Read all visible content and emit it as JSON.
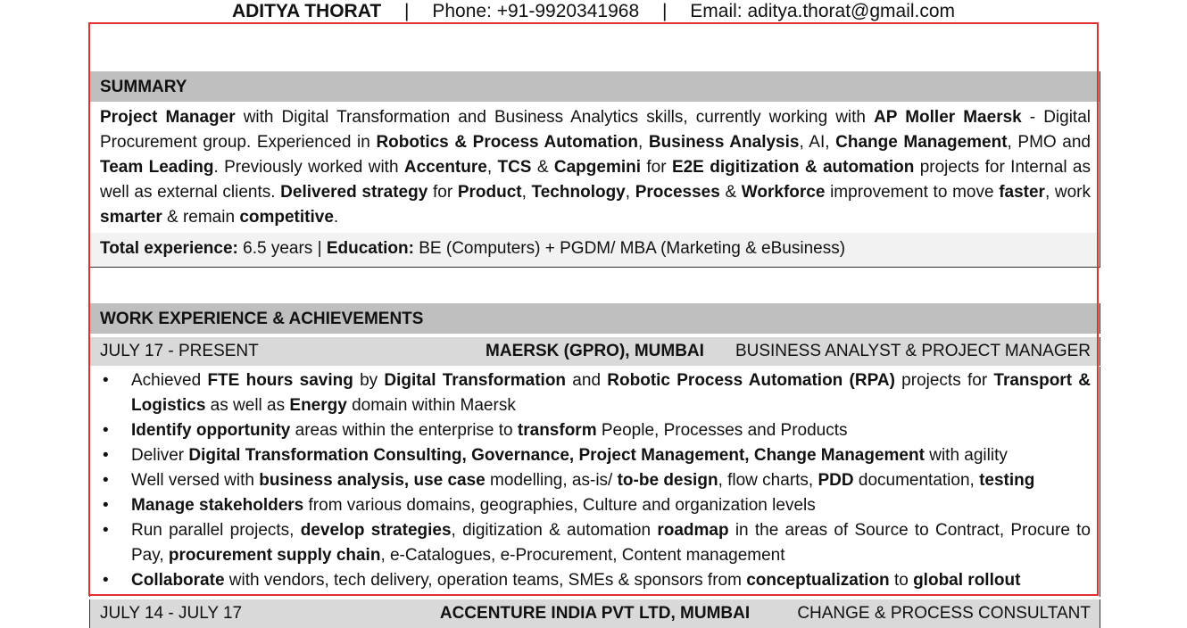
{
  "header": {
    "name": "ADITYA THORAT",
    "separator": "|",
    "phone": "Phone: +91-9920341968",
    "email": "Email: aditya.thorat@gmail.com"
  },
  "summary": {
    "heading": "SUMMARY",
    "segments": [
      {
        "t": "Project Manager",
        "b": true
      },
      {
        "t": " with Digital Transformation and Business Analytics skills, currently working with ",
        "b": false
      },
      {
        "t": "AP Moller Maersk",
        "b": true
      },
      {
        "t": " - Digital Procurement group. Experienced in ",
        "b": false
      },
      {
        "t": "Robotics & Process Automation",
        "b": true
      },
      {
        "t": ", ",
        "b": false
      },
      {
        "t": "Business Analysis",
        "b": true
      },
      {
        "t": ", AI, ",
        "b": false
      },
      {
        "t": "Change Management",
        "b": true
      },
      {
        "t": ", PMO and ",
        "b": false
      },
      {
        "t": "Team Leading",
        "b": true
      },
      {
        "t": ". Previously worked with ",
        "b": false
      },
      {
        "t": "Accenture",
        "b": true
      },
      {
        "t": ", ",
        "b": false
      },
      {
        "t": "TCS",
        "b": true
      },
      {
        "t": " & ",
        "b": false
      },
      {
        "t": "Capgemini",
        "b": true
      },
      {
        "t": " for ",
        "b": false
      },
      {
        "t": "E2E digitization & automation",
        "b": true
      },
      {
        "t": " projects for Internal as well as external clients. ",
        "b": false
      },
      {
        "t": "Delivered strategy",
        "b": true
      },
      {
        "t": " for ",
        "b": false
      },
      {
        "t": "Product",
        "b": true
      },
      {
        "t": ", ",
        "b": false
      },
      {
        "t": "Technology",
        "b": true
      },
      {
        "t": ", ",
        "b": false
      },
      {
        "t": "Processes",
        "b": true
      },
      {
        "t": " & ",
        "b": false
      },
      {
        "t": "Workforce",
        "b": true
      },
      {
        "t": " improvement to move ",
        "b": false
      },
      {
        "t": "faster",
        "b": true
      },
      {
        "t": ", work ",
        "b": false
      },
      {
        "t": "smarter",
        "b": true
      },
      {
        "t": " & remain ",
        "b": false
      },
      {
        "t": "competitive",
        "b": true
      },
      {
        "t": ".",
        "b": false
      }
    ],
    "totals": [
      {
        "t": "Total experience:",
        "b": true
      },
      {
        "t": " 6.5 years | ",
        "b": false
      },
      {
        "t": "Education:",
        "b": true
      },
      {
        "t": " BE (Computers) + PGDM/ MBA (Marketing & eBusiness)",
        "b": false
      }
    ]
  },
  "work": {
    "heading": "WORK EXPERIENCE & ACHIEVEMENTS",
    "jobs": [
      {
        "date": "JULY 17 - PRESENT",
        "company": "MAERSK (GPRO), MUMBAI",
        "role": "BUSINESS ANALYST & PROJECT MANAGER"
      },
      {
        "date": "JULY 14 - JULY 17",
        "company": "ACCENTURE INDIA PVT LTD, MUMBAI",
        "role": "CHANGE & PROCESS CONSULTANT"
      }
    ],
    "bullet_symbol": "•",
    "bullets": [
      [
        {
          "t": "Achieved ",
          "b": false
        },
        {
          "t": "FTE hours saving",
          "b": true
        },
        {
          "t": " by ",
          "b": false
        },
        {
          "t": "Digital Transformation",
          "b": true
        },
        {
          "t": " and ",
          "b": false
        },
        {
          "t": "Robotic Process Automation (RPA)",
          "b": true
        },
        {
          "t": " projects for ",
          "b": false
        },
        {
          "t": "Transport & Logistics",
          "b": true
        },
        {
          "t": " as well as ",
          "b": false
        },
        {
          "t": "Energy",
          "b": true
        },
        {
          "t": " domain within Maersk",
          "b": false
        }
      ],
      [
        {
          "t": "Identify opportunity",
          "b": true
        },
        {
          "t": " areas within the enterprise to ",
          "b": false
        },
        {
          "t": "transform",
          "b": true
        },
        {
          "t": " People, Processes and Products",
          "b": false
        }
      ],
      [
        {
          "t": "Deliver ",
          "b": false
        },
        {
          "t": "Digital Transformation Consulting, Governance, Project Management, Change Management",
          "b": true
        },
        {
          "t": " with agility",
          "b": false
        }
      ],
      [
        {
          "t": "Well versed with ",
          "b": false
        },
        {
          "t": "business analysis, use case",
          "b": true
        },
        {
          "t": " modelling, as-is/ ",
          "b": false
        },
        {
          "t": "to-be design",
          "b": true
        },
        {
          "t": ", flow charts, ",
          "b": false
        },
        {
          "t": "PDD",
          "b": true
        },
        {
          "t": " documentation, ",
          "b": false
        },
        {
          "t": "testing",
          "b": true
        }
      ],
      [
        {
          "t": "Manage stakeholders",
          "b": true
        },
        {
          "t": " from various domains, geographies, Culture and organization levels",
          "b": false
        }
      ],
      [
        {
          "t": "Run parallel projects, ",
          "b": false
        },
        {
          "t": "develop strategies",
          "b": true
        },
        {
          "t": ", digitization & automation ",
          "b": false
        },
        {
          "t": "roadmap",
          "b": true
        },
        {
          "t": " in the areas of Source to Contract, Procure to Pay, ",
          "b": false
        },
        {
          "t": "procurement supply chain",
          "b": true
        },
        {
          "t": ", e-Catalogues, e-Procurement, Content management",
          "b": false
        }
      ],
      [
        {
          "t": "Collaborate",
          "b": true
        },
        {
          "t": " with vendors, tech delivery, operation teams, SMEs & sponsors from ",
          "b": false
        },
        {
          "t": "conceptualization",
          "b": true
        },
        {
          "t": " to ",
          "b": false
        },
        {
          "t": "global rollout",
          "b": true
        }
      ]
    ]
  }
}
